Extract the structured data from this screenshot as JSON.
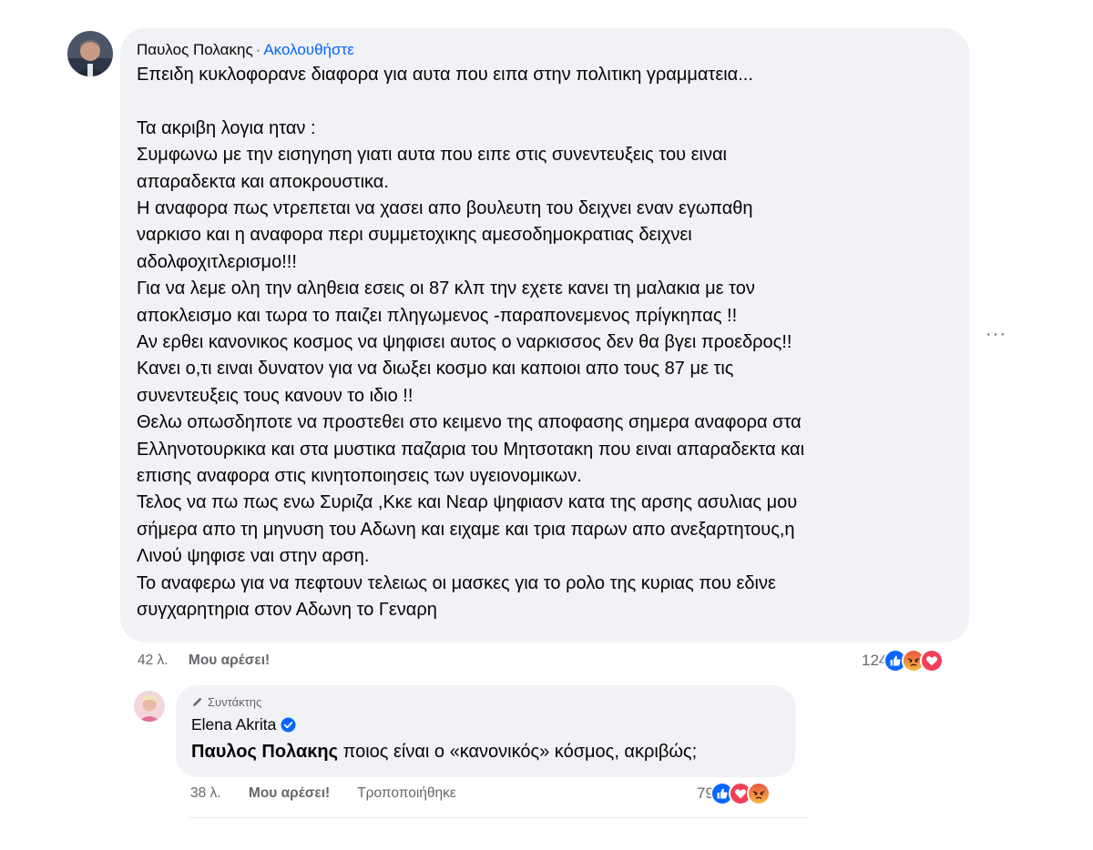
{
  "main_comment": {
    "author": "Παυλος Πολακης",
    "separator": "·",
    "follow_label": "Ακολουθήστε",
    "lines": [
      "Επειδη κυκλοφορανε διαφορα για αυτα που ειπα στην πολιτικη γραμματεια...",
      "",
      "Τα ακριβη λογια ηταν :",
      "Συμφωνω με την εισηγηση γιατι αυτα που ειπε στις συνεντευξεις του ειναι",
      "απαραδεκτα και αποκρουστικα.",
      "Η αναφορα πως ντρεπεται να χασει απο βουλευτη του δειχνει εναν εγωπαθη",
      "ναρκισο και η αναφορα περι συμμετοχικης αμεσοδημοκρατιας δειχνει",
      "αδολφοχιτλερισμο!!!",
      "Για να λεμε ολη την αληθεια εσεις οι 87 κλπ την εχετε κανει τη μαλακια με τον",
      "αποκλεισμο και τωρα το παιζει πληγωμενος -παραπονεμενος πρίγκηπας !!",
      "Αν ερθει κανονικος κοσμος να ψηφισει αυτος ο ναρκισσος δεν θα βγει προεδρος!!",
      "Κανει ο,τι ειναι δυνατον για να διωξει κοσμο και καποιοι απο τους 87 με τις",
      "συνεντευξεις τους κανουν το ιδιο !!",
      "Θελω οπωσδηποτε να προστεθει στο κειμενο της αποφασης σημερα αναφορα στα",
      "Ελληνοτουρκικα και στα μυστικα παζαρια του Μητσοτακη που ειναι απαραδεκτα και",
      "επισης αναφορα στις κινητοποιησεις των υγειονομικων.",
      "Τελος να πω πως ενω Συριζα ,Κκε και Νεαρ ψηφιασν κατα της αρσης ασυλιας μου",
      "σήμερα απο τη μηνυση του Αδωνη και ειχαμε και τρια παρων απο ανεξαρτητους,η",
      "Λινού ψηφισε ναι στην αρση.",
      "Το αναφερω για να πεφτουν τελειως οι μασκες για το ρολο της κυριας που εδινε",
      "συγχαρητηρια στον Αδωνη το Γεναρη"
    ],
    "age": "42 λ.",
    "like_label": "Μου αρέσει!",
    "reaction_count": "124",
    "reactions": [
      "like-reaction-icon",
      "angry-reaction-icon",
      "love-reaction-icon"
    ],
    "more_label": "···"
  },
  "reply": {
    "badge": "Συντάκτης",
    "author": "Elena Akrita",
    "mention": "Παυλος Πολακης",
    "text": " ποιος είναι ο «κανονικός» κόσμος, ακριβώς;",
    "age": "38 λ.",
    "like_label": "Μου αρέσει!",
    "edited_label": "Τροποποιήθηκε",
    "reaction_count": "79",
    "reactions": [
      "like-reaction-icon",
      "love-reaction-icon",
      "angry-reaction-icon"
    ]
  },
  "colors": {
    "bubble": "#f0f2f5",
    "link": "#0866ff",
    "secondary_text": "#65676b",
    "like_blue": "#0866ff",
    "love_red": "#f33e58",
    "angry_orange": "#f7714c"
  }
}
